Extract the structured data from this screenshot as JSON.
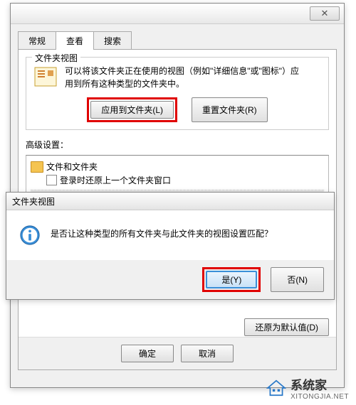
{
  "main_window": {
    "tabs": [
      "常规",
      "查看",
      "搜索"
    ],
    "active_tab": 1,
    "folder_view": {
      "group_title": "文件夹视图",
      "description": "可以将该文件夹正在使用的视图（例如\"详细信息\"或\"图标\"）应用到所有这种类型的文件夹中。",
      "apply_btn": "应用到文件夹(L)",
      "reset_btn": "重置文件夹(R)"
    },
    "advanced": {
      "label": "高级设置：",
      "root": "文件和文件夹",
      "item1": "登录时还原上一个文件夹窗口"
    },
    "restore_defaults": "还原为默认值(D)",
    "ok": "确定",
    "cancel": "取消"
  },
  "confirm_dialog": {
    "title": "文件夹视图",
    "message": "是否让这种类型的所有文件夹与此文件夹的视图设置匹配？",
    "yes": "是(Y)",
    "no": "否(N)"
  },
  "watermark": {
    "brand": "系统家",
    "url": "XITONGJIA.NET"
  }
}
